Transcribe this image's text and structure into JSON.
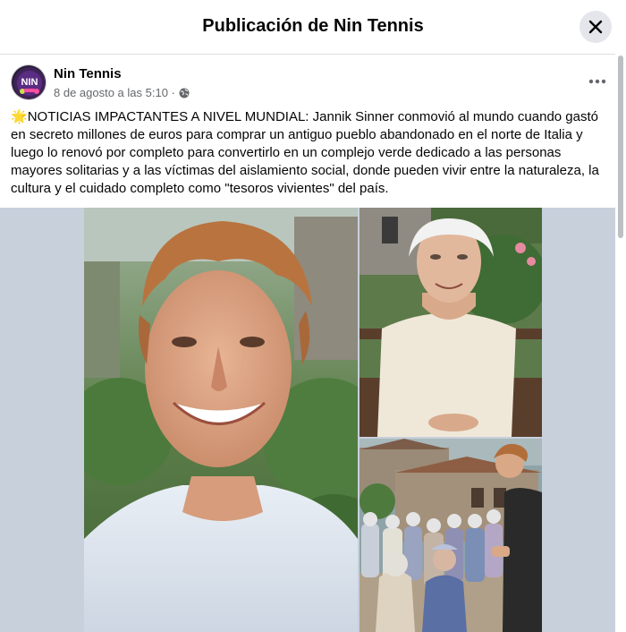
{
  "modal": {
    "title": "Publicación de Nin Tennis",
    "close_icon": "close-icon"
  },
  "post": {
    "author": "Nin Tennis",
    "timestamp": "8 de agosto a las 5:10 ·",
    "privacy_icon": "globe-icon",
    "more_icon": "more-horizontal-icon",
    "avatar_text": "NIN",
    "text_emoji": "🌟",
    "text": "NOTICIAS IMPACTANTES A NIVEL MUNDIAL: Jannik Sinner conmovió al mundo cuando gastó en secreto millones de euros para comprar un antiguo pueblo abandonado en el norte de Italia y luego lo renovó por completo para convertirlo en un complejo verde dedicado a las personas mayores solitarias y a las víctimas del aislamiento social, donde pueden vivir entre la naturaleza, la cultura y el cuidado completo como \"tesoros vivientes\" del país."
  },
  "colors": {
    "media_background": "#c8d0dc",
    "secondary_text": "#65676b",
    "close_button_bg": "#e4e6eb"
  }
}
